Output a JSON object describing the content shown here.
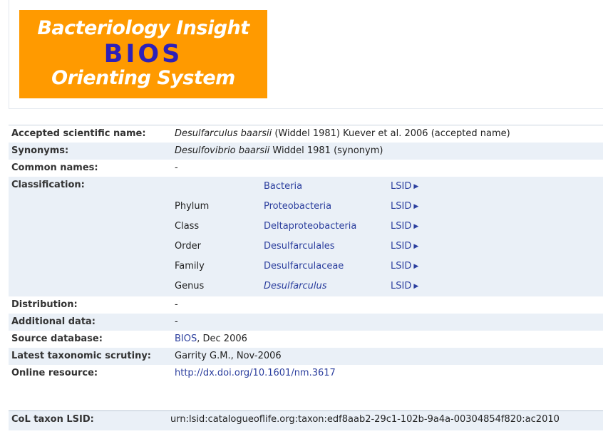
{
  "logo": {
    "line1": "Bacteriology Insight",
    "line2": "BIOS",
    "line3": "Orienting System",
    "bg_color": "#ff9a00",
    "accent_color": "#2d20b8"
  },
  "details": {
    "accepted": {
      "label": "Accepted scientific name:",
      "genus_species": "Desulfarculus baarsii",
      "rest": " (Widdel 1981) Kuever et al. 2006 (accepted name)"
    },
    "synonyms": {
      "label": "Synonyms:",
      "name": "Desulfovibrio baarsii",
      "rest": " Widdel 1981 (synonym)"
    },
    "common_names": {
      "label": "Common names:",
      "value": "-"
    },
    "classification": {
      "label": "Classification:",
      "rows": [
        {
          "rank": "",
          "name": "Bacteria",
          "lsid": "LSID",
          "italic": false
        },
        {
          "rank": "Phylum",
          "name": "Proteobacteria",
          "lsid": "LSID",
          "italic": false
        },
        {
          "rank": "Class",
          "name": "Deltaproteobacteria",
          "lsid": "LSID",
          "italic": false
        },
        {
          "rank": "Order",
          "name": "Desulfarculales",
          "lsid": "LSID",
          "italic": false
        },
        {
          "rank": "Family",
          "name": "Desulfarculaceae",
          "lsid": "LSID",
          "italic": false
        },
        {
          "rank": "Genus",
          "name": "Desulfarculus",
          "lsid": "LSID",
          "italic": true
        }
      ]
    },
    "distribution": {
      "label": "Distribution:",
      "value": "-"
    },
    "additional": {
      "label": "Additional data:",
      "value": "-"
    },
    "source": {
      "label": "Source database:",
      "link": "BIOS",
      "rest": ", Dec 2006"
    },
    "scrutiny": {
      "label": "Latest taxonomic scrutiny:",
      "value": "Garrity G.M., Nov-2006"
    },
    "online": {
      "label": "Online resource:",
      "link": "http://dx.doi.org/10.1601/nm.3617"
    }
  },
  "col_lsid": {
    "label": "CoL taxon LSID:",
    "value": "urn:lsid:catalogueoflife.org:taxon:edf8aab2-29c1-102b-9a4a-00304854f820:ac2010"
  },
  "colors": {
    "link": "#2c3f9e",
    "row_shade": "#eaf0f7"
  }
}
